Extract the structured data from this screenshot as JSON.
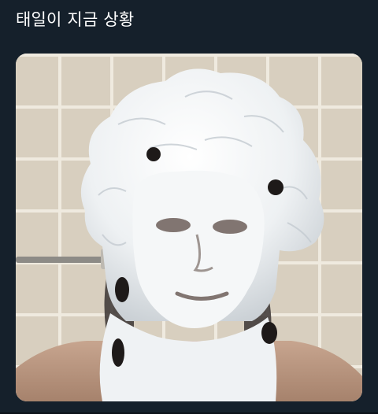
{
  "tweet": {
    "text": "태일이 지금 상황"
  },
  "media": {
    "icon": "photo-icon",
    "subject": "foam-covered-face-photo"
  },
  "colors": {
    "background": "#15202b",
    "text": "#ffffff",
    "tile": "#d8cfbf",
    "grout": "#f1ede4",
    "foam": "#f3f5f6"
  }
}
